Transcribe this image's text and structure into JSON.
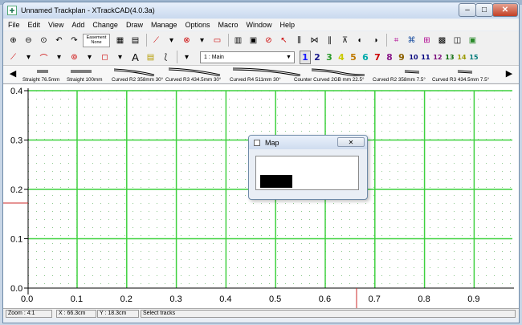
{
  "window": {
    "title": "Unnamed Trackplan - XTrackCAD(4.0.3a)",
    "controls": {
      "minimize": "–",
      "maximize": "□",
      "close": "✕"
    }
  },
  "menu": [
    "File",
    "Edit",
    "View",
    "Add",
    "Change",
    "Draw",
    "Manage",
    "Options",
    "Macro",
    "Window",
    "Help"
  ],
  "toolbar": {
    "easement_line1": "Easement",
    "easement_line2": "None",
    "icons_row1": [
      "zoom-in-icon",
      "zoom-out-icon",
      "zoom-fit-icon",
      "undo-icon",
      "redo-icon",
      "easement-button",
      "select-icon",
      "print-icon",
      "track-icon",
      "track-dropdown-icon",
      "turnout-icon",
      "turnout-dropdown-icon",
      "table-edge-icon",
      "rotate-icon",
      "move-icon",
      "delete-icon",
      "describe-icon",
      "split-icon",
      "join-icon",
      "parallel-icon",
      "elevation-icon",
      "profile-icon",
      "hand-laid-icon",
      "block-icon",
      "switch-motor-icon",
      "signal-icon",
      "hide-icon",
      "train-icon"
    ],
    "layer_selected": "1 : Main",
    "layer_buttons": [
      {
        "label": "1",
        "color": "#1a1aff"
      },
      {
        "label": "2",
        "color": "#1a1a8c"
      },
      {
        "label": "3",
        "color": "#2a9a2a"
      },
      {
        "label": "4",
        "color": "#c9c900"
      },
      {
        "label": "5",
        "color": "#c07a00"
      },
      {
        "label": "6",
        "color": "#00aaaa"
      },
      {
        "label": "7",
        "color": "#cc0000"
      },
      {
        "label": "8",
        "color": "#8a1a8a"
      },
      {
        "label": "9",
        "color": "#8c6000"
      },
      {
        "label": "10",
        "color": "#0a0a80"
      },
      {
        "label": "11",
        "color": "#000080"
      },
      {
        "label": "12",
        "color": "#7a0a7a"
      },
      {
        "label": "13",
        "color": "#0a6a0a"
      },
      {
        "label": "14",
        "color": "#9a9a00"
      },
      {
        "label": "15",
        "color": "#007a7a"
      }
    ]
  },
  "hotbar": {
    "items": [
      "Straight 76.5mm",
      "Straight 100mm",
      "Curved R2 358mm 30°",
      "Curved R3 434.5mm 30°",
      "Curved R4 511mm 30°",
      "Counter Curved 2GB mm 22.5°",
      "Curved R2 358mm 7.5°",
      "Curved R3 434.5mm 7.5°"
    ]
  },
  "canvas": {
    "y_ticks": [
      "0.4",
      "0.3",
      "0.2",
      "0.1",
      "0.0"
    ],
    "x_ticks": [
      "0.0",
      "0.1",
      "0.2",
      "0.3",
      "0.4",
      "0.5",
      "0.6",
      "0.7",
      "0.8",
      "0.9"
    ],
    "grid_color": "#3fd13f",
    "dot_color": "#6ab86a",
    "cursor_marker_color": "#cc2a2a"
  },
  "status": {
    "zoom": "Zoom : 4:1",
    "x": "X : 66.3cm",
    "y": "Y : 18.3cm",
    "message": "Select tracks"
  },
  "map_dialog": {
    "title": "Map",
    "close": "✕"
  }
}
